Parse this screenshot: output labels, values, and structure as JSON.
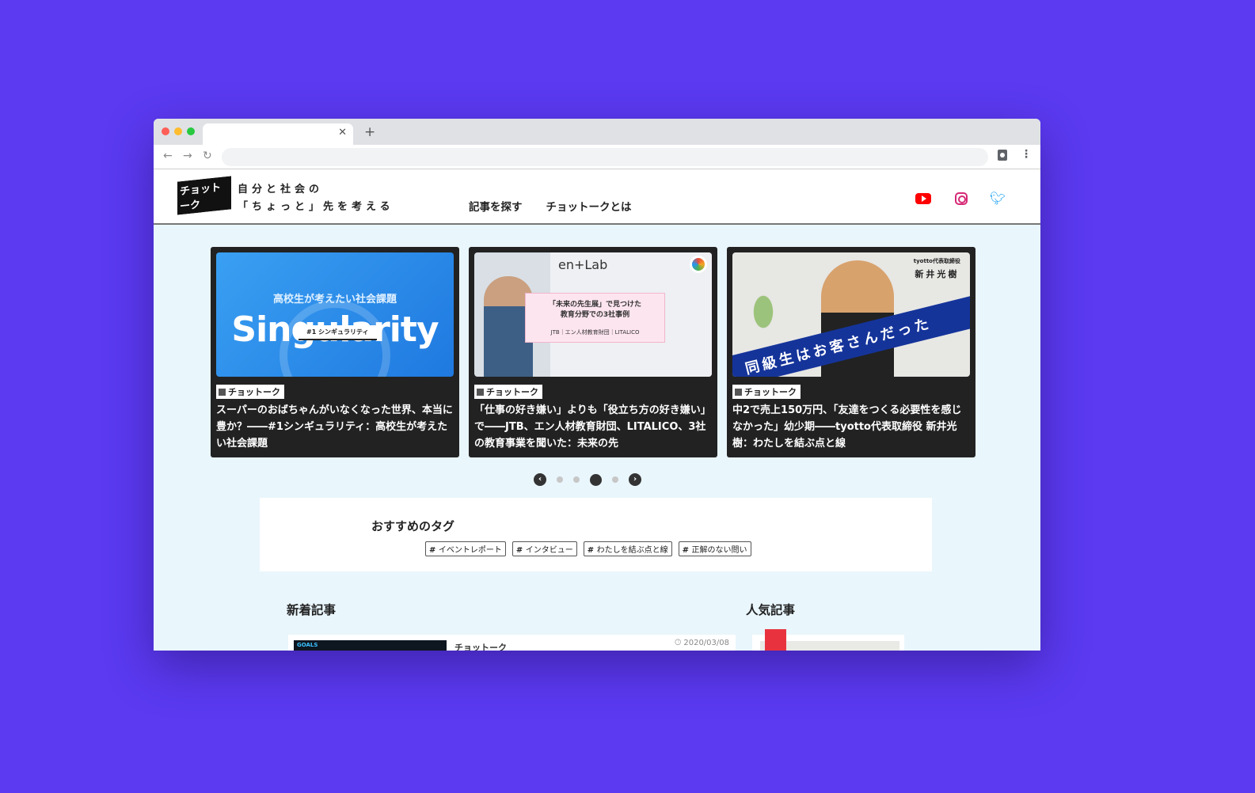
{
  "header": {
    "logo_text": "チョットーク",
    "tagline_line1": "自分と社会の",
    "tagline_line2": "「ちょっと」先を考える",
    "nav": [
      "記事を探す",
      "チョットークとは"
    ],
    "social": [
      "youtube-icon",
      "instagram-icon",
      "twitter-icon"
    ]
  },
  "carousel": {
    "cards": [
      {
        "category": "チョットーク",
        "title": "スーパーのおばちゃんがいなくなった世界、本当に豊か？――#1シンギュラリティ：高校生が考えたい社会課題",
        "image_subtitle": "高校生が考えたい社会課題",
        "image_heading": "Singularity",
        "image_tag": "#1 シンギュラリティ"
      },
      {
        "category": "チョットーク",
        "title": "「仕事の好き嫌い」よりも「役立ち方の好き嫌い」で――JTB、エン人材教育財団、LITALICO、3社の教育事業を聞いた：未来の先",
        "image_board": "en+Lab",
        "image_sign_line1": "「未来の先生展」で見つけた",
        "image_sign_line2": "教育分野での3社事例",
        "image_sign_small": "JTB｜エン人材教育財団｜LITALICO"
      },
      {
        "category": "チョットーク",
        "title": "中2で売上150万円、「友達をつくる必要性を感じなかった」幼少期――tyotto代表取締役 新井光樹：わたしを結ぶ点と線",
        "image_role": "tyotto代表取締役",
        "image_name": "新井光樹",
        "image_band": "同級生はお客さんだった"
      }
    ],
    "pager": {
      "count": 4,
      "active": 3
    }
  },
  "tags": {
    "title": "おすすめのタグ",
    "items": [
      "イベントレポート",
      "インタビュー",
      "わたしを結ぶ点と線",
      "正解のない問い"
    ]
  },
  "new_posts": {
    "title": "新着記事",
    "first": {
      "category": "チョットーク",
      "date": "2020/03/08",
      "thumb_label": "GOALS"
    }
  },
  "popular": {
    "title": "人気記事"
  },
  "colors": {
    "background": "#5b3af1",
    "page": "#e9f6fc",
    "card": "#222222"
  }
}
